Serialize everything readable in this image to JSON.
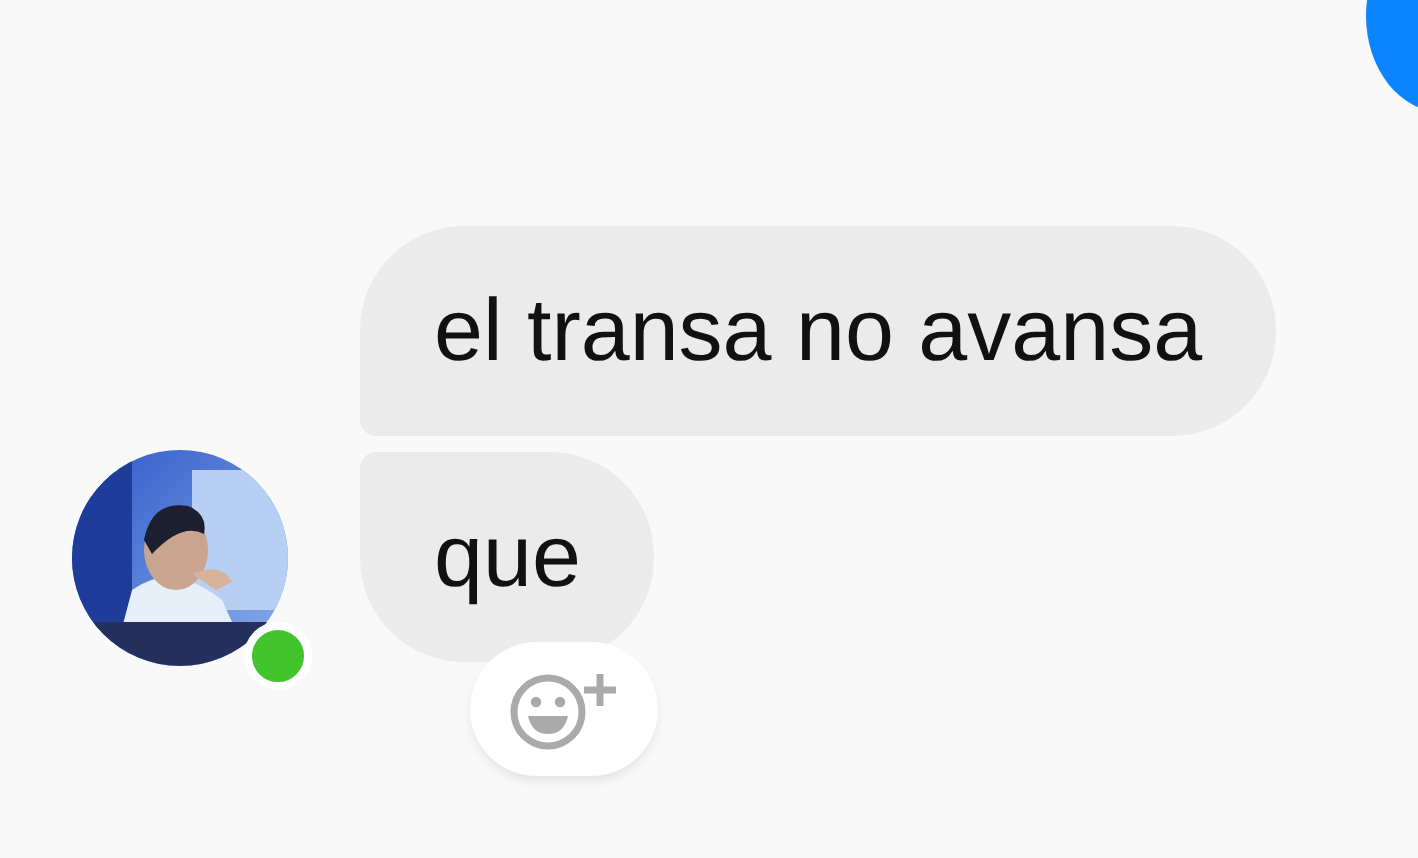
{
  "messages": [
    {
      "text": "el transa no avansa"
    },
    {
      "text": "que"
    }
  ],
  "sender": {
    "online": true
  }
}
